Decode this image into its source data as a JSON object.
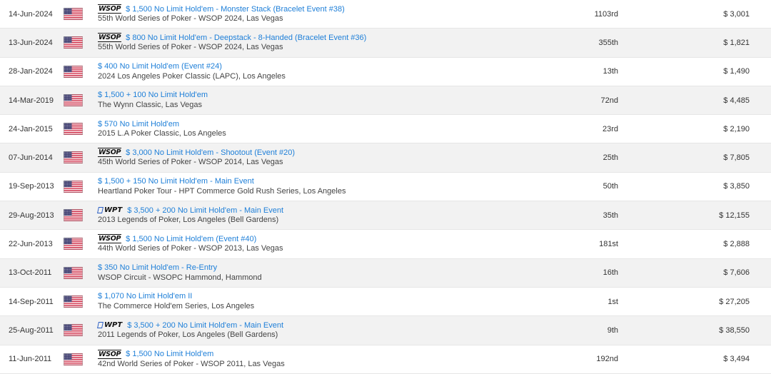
{
  "currency_symbol": "$",
  "results": [
    {
      "date": "14-Jun-2024",
      "country": "us-flag",
      "logo": "WSOP",
      "event": "$ 1,500 No Limit Hold'em - Monster Stack (Bracelet Event #38)",
      "venue": "55th World Series of Poker - WSOP 2024, Las Vegas",
      "place": "1103rd",
      "prize": "$ 3,001"
    },
    {
      "date": "13-Jun-2024",
      "country": "us-flag",
      "logo": "WSOP",
      "event": "$ 800 No Limit Hold'em - Deepstack - 8-Handed (Bracelet Event #36)",
      "venue": "55th World Series of Poker - WSOP 2024, Las Vegas",
      "place": "355th",
      "prize": "$ 1,821"
    },
    {
      "date": "28-Jan-2024",
      "country": "us-flag",
      "logo": "",
      "event": "$ 400 No Limit Hold'em (Event #24)",
      "venue": "2024 Los Angeles Poker Classic (LAPC), Los Angeles",
      "place": "13th",
      "prize": "$ 1,490"
    },
    {
      "date": "14-Mar-2019",
      "country": "us-flag",
      "logo": "",
      "event": "$ 1,500 + 100 No Limit Hold'em",
      "venue": "The Wynn Classic, Las Vegas",
      "place": "72nd",
      "prize": "$ 4,485"
    },
    {
      "date": "24-Jan-2015",
      "country": "us-flag",
      "logo": "",
      "event": "$ 570 No Limit Hold'em",
      "venue": "2015 L.A Poker Classic, Los Angeles",
      "place": "23rd",
      "prize": "$ 2,190"
    },
    {
      "date": "07-Jun-2014",
      "country": "us-flag",
      "logo": "WSOP",
      "event": "$ 3,000 No Limit Hold'em - Shootout (Event #20)",
      "venue": "45th World Series of Poker - WSOP 2014, Las Vegas",
      "place": "25th",
      "prize": "$ 7,805"
    },
    {
      "date": "19-Sep-2013",
      "country": "us-flag",
      "logo": "",
      "event": "$ 1,500 + 150 No Limit Hold'em - Main Event",
      "venue": "Heartland Poker Tour - HPT Commerce Gold Rush Series, Los Angeles",
      "place": "50th",
      "prize": "$ 3,850"
    },
    {
      "date": "29-Aug-2013",
      "country": "us-flag",
      "logo": "WPT",
      "event": "$ 3,500 + 200 No Limit Hold'em - Main Event",
      "venue": "2013 Legends of Poker, Los Angeles (Bell Gardens)",
      "place": "35th",
      "prize": "$ 12,155"
    },
    {
      "date": "22-Jun-2013",
      "country": "us-flag",
      "logo": "WSOP",
      "event": "$ 1,500 No Limit Hold'em (Event #40)",
      "venue": "44th World Series of Poker - WSOP 2013, Las Vegas",
      "place": "181st",
      "prize": "$ 2,888"
    },
    {
      "date": "13-Oct-2011",
      "country": "us-flag",
      "logo": "",
      "event": "$ 350 No Limit Hold'em - Re-Entry",
      "venue": "WSOP Circuit - WSOPC Hammond, Hammond",
      "place": "16th",
      "prize": "$ 7,606"
    },
    {
      "date": "14-Sep-2011",
      "country": "us-flag",
      "logo": "",
      "event": "$ 1,070 No Limit Hold'em II",
      "venue": "The Commerce Hold'em Series, Los Angeles",
      "place": "1st",
      "prize": "$ 27,205"
    },
    {
      "date": "25-Aug-2011",
      "country": "us-flag",
      "logo": "WPT",
      "event": "$ 3,500 + 200 No Limit Hold'em - Main Event",
      "venue": "2011 Legends of Poker, Los Angeles (Bell Gardens)",
      "place": "9th",
      "prize": "$ 38,550"
    },
    {
      "date": "11-Jun-2011",
      "country": "us-flag",
      "logo": "WSOP",
      "event": "$ 1,500 No Limit Hold'em",
      "venue": "42nd World Series of Poker - WSOP 2011, Las Vegas",
      "place": "192nd",
      "prize": "$ 3,494"
    }
  ],
  "colors": {
    "link": "#1e7fd8",
    "row_alt": "#f2f2f2",
    "text": "#333333"
  }
}
